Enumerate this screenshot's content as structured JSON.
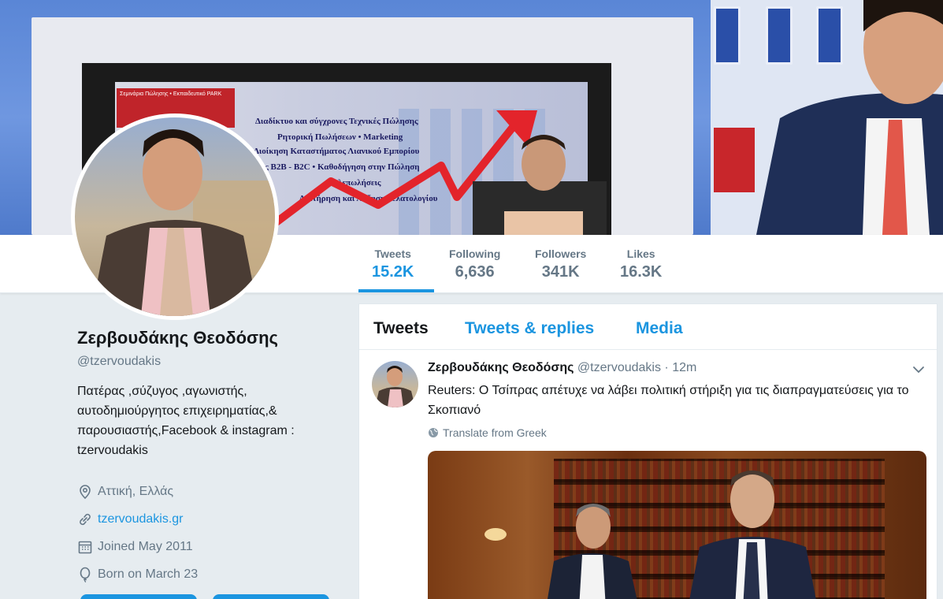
{
  "banner": {
    "screen_lines": [
      "Διαδίκτυο και σύγχρονες Τεχνικές Πώλησης",
      "Ρητορική Πωλήσεων  •  Marketing",
      "Διοίκηση Καταστήματος Λιανικού Εμπορίου",
      "σεις B2B - B2C  •  Καθοδήγηση στην Πώληση",
      "Τηλεπωλήσεις",
      "Διατήρηση και Αύξηση πελατολογίου"
    ],
    "redbox_text": "Σεμινάρια Πώλησης • Εκπαιδευτικό PARK"
  },
  "stats": [
    {
      "label": "Tweets",
      "value": "15.2K"
    },
    {
      "label": "Following",
      "value": "6,636"
    },
    {
      "label": "Followers",
      "value": "341K"
    },
    {
      "label": "Likes",
      "value": "16.3K"
    }
  ],
  "profile": {
    "name": "Ζερβουδάκης Θεοδόσης",
    "handle": "@tzervoudakis",
    "bio": "Πατέρας ,σύζυγος ,αγωνιστής, αυτοδημιούργητος επιχειρηματίας,& παρουσιαστής,Facebook & instagram : tzervoudakis",
    "location": "Αττική, Ελλάς",
    "website": "tzervoudakis.gr",
    "joined": "Joined May 2011",
    "born": "Born on March 23"
  },
  "tabs": [
    "Tweets",
    "Tweets & replies",
    "Media"
  ],
  "tweet": {
    "name": "Ζερβουδάκης Θεοδόσης",
    "handle": "@tzervoudakis",
    "dot": "·",
    "time": "12m",
    "text": "Reuters: Ο Τσίπρας απέτυχε να λάβει πολιτική στήριξη για τις διαπραγματεύσεις για το Σκοπιανό",
    "translate": "Translate from Greek"
  },
  "colors": {
    "accent": "#1b95e0",
    "muted": "#657786",
    "background": "#e6ecf0"
  },
  "icons": [
    "location-icon",
    "link-icon",
    "calendar-icon",
    "balloon-icon",
    "globe-icon",
    "chevron-down-icon"
  ]
}
